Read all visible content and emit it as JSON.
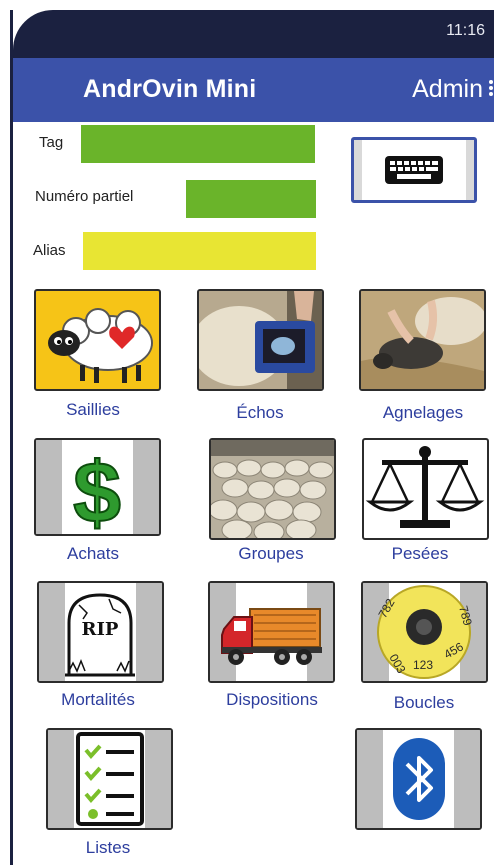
{
  "status": {
    "time": "11:16"
  },
  "appbar": {
    "title": "AndrOvin Mini",
    "user": "Admin"
  },
  "form": {
    "tag_label": "Tag",
    "partial_label": "Numéro partiel",
    "alias_label": "Alias",
    "colors": {
      "tag": "#6ab42a",
      "partial": "#6ab42a",
      "alias": "#e8e533"
    }
  },
  "tiles": [
    {
      "label": "Saillies",
      "icon": "sheep-heart-icon"
    },
    {
      "label": "Échos",
      "icon": "ultrasound-photo"
    },
    {
      "label": "Agnelages",
      "icon": "lambing-photo"
    },
    {
      "label": "Achats",
      "icon": "dollar-icon"
    },
    {
      "label": "Groupes",
      "icon": "flock-photo"
    },
    {
      "label": "Pesées",
      "icon": "scale-icon"
    },
    {
      "label": "Mortalités",
      "icon": "tombstone-icon",
      "tomb_text": "RIP"
    },
    {
      "label": "Dispositions",
      "icon": "truck-icon"
    },
    {
      "label": "Boucles",
      "icon": "ear-tag-icon",
      "tag_text": [
        "782",
        "003",
        "123",
        "456",
        "789"
      ]
    },
    {
      "label": "Listes",
      "icon": "checklist-icon"
    },
    {
      "label": "",
      "icon": "bluetooth-icon"
    }
  ],
  "theme": {
    "appbar": "#3b52a9",
    "statusbar": "#1b2140",
    "label_color": "#2d3e9e"
  }
}
